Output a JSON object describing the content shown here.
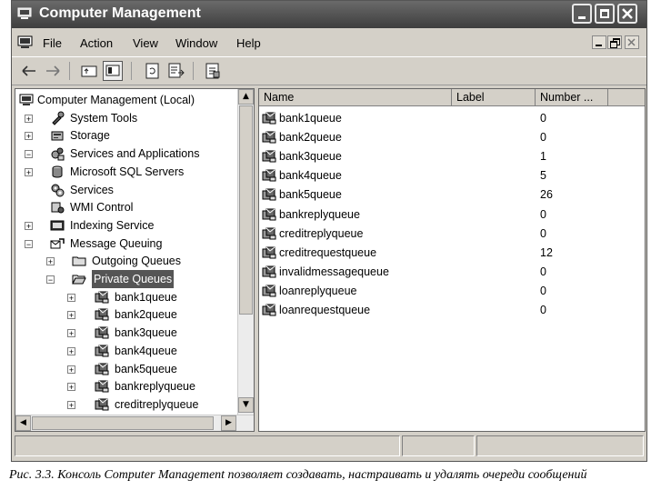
{
  "window": {
    "title": "Computer Management"
  },
  "menu": [
    "File",
    "Action",
    "View",
    "Window",
    "Help"
  ],
  "tree": [
    {
      "label": "Computer Management (Local)",
      "icon": "computer-icon",
      "expander": "",
      "level": 0
    },
    {
      "label": "System Tools",
      "icon": "tools-icon",
      "expander": "+",
      "level": 1
    },
    {
      "label": "Storage",
      "icon": "storage-icon",
      "expander": "+",
      "level": 1
    },
    {
      "label": "Services and Applications",
      "icon": "services-apps-icon",
      "expander": "−",
      "level": 1
    },
    {
      "label": "Microsoft SQL Servers",
      "icon": "database-icon",
      "expander": "+",
      "level": 2
    },
    {
      "label": "Services",
      "icon": "gears-icon",
      "expander": "",
      "level": 2
    },
    {
      "label": "WMI Control",
      "icon": "wmi-icon",
      "expander": "",
      "level": 2
    },
    {
      "label": "Indexing Service",
      "icon": "indexing-icon",
      "expander": "+",
      "level": 2
    },
    {
      "label": "Message Queuing",
      "icon": "message-queuing-icon",
      "expander": "−",
      "level": 2
    },
    {
      "label": "Outgoing Queues",
      "icon": "folder-icon",
      "expander": "+",
      "level": 3
    },
    {
      "label": "Private Queues",
      "icon": "open-folder-icon",
      "expander": "−",
      "level": 3,
      "selected": true
    },
    {
      "label": "bank1queue",
      "icon": "queue-icon",
      "expander": "+",
      "level": 4
    },
    {
      "label": "bank2queue",
      "icon": "queue-icon",
      "expander": "+",
      "level": 4
    },
    {
      "label": "bank3queue",
      "icon": "queue-icon",
      "expander": "+",
      "level": 4
    },
    {
      "label": "bank4queue",
      "icon": "queue-icon",
      "expander": "+",
      "level": 4
    },
    {
      "label": "bank5queue",
      "icon": "queue-icon",
      "expander": "+",
      "level": 4
    },
    {
      "label": "bankreplyqueue",
      "icon": "queue-icon",
      "expander": "+",
      "level": 4
    },
    {
      "label": "creditreplyqueue",
      "icon": "queue-icon",
      "expander": "+",
      "level": 4
    }
  ],
  "list": {
    "columns": [
      "Name",
      "Label",
      "Number ..."
    ],
    "rows": [
      {
        "name": "bank1queue",
        "label": "",
        "number": "0"
      },
      {
        "name": "bank2queue",
        "label": "",
        "number": "0"
      },
      {
        "name": "bank3queue",
        "label": "",
        "number": "1"
      },
      {
        "name": "bank4queue",
        "label": "",
        "number": "5"
      },
      {
        "name": "bank5queue",
        "label": "",
        "number": "26"
      },
      {
        "name": "bankreplyqueue",
        "label": "",
        "number": "0"
      },
      {
        "name": "creditreplyqueue",
        "label": "",
        "number": "0"
      },
      {
        "name": "creditrequestqueue",
        "label": "",
        "number": "12"
      },
      {
        "name": "invalidmessagequeue",
        "label": "",
        "number": "0"
      },
      {
        "name": "loanreplyqueue",
        "label": "",
        "number": "0"
      },
      {
        "name": "loanrequestqueue",
        "label": "",
        "number": "0"
      }
    ]
  },
  "caption": "Рис. 3.3. Консоль Computer Management позволяет создавать, настраивать и удалять очереди сообщений"
}
